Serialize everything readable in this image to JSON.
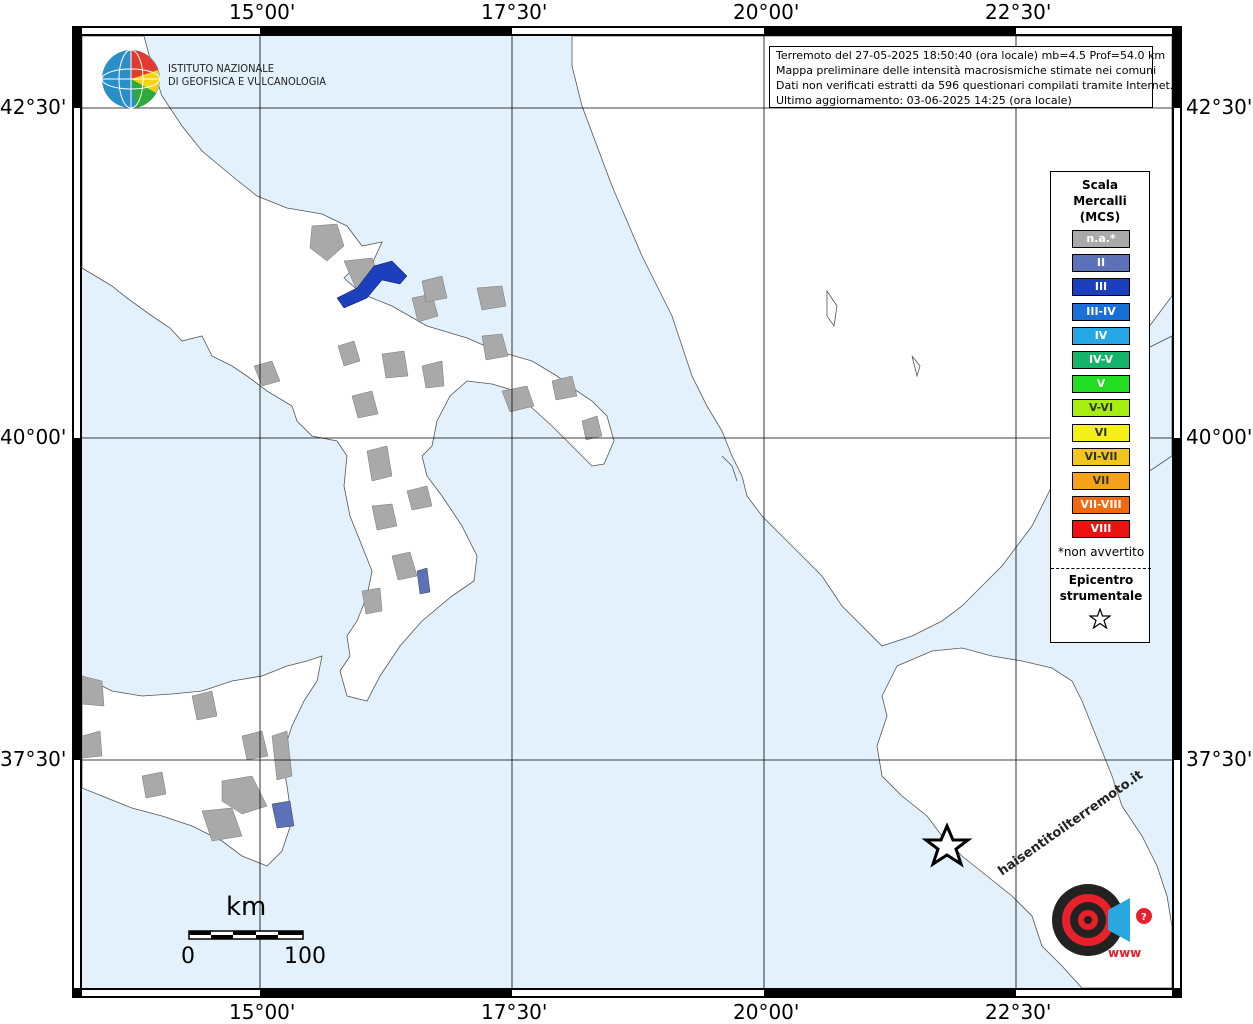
{
  "map": {
    "lon_labels_top": [
      "15°00'",
      "17°30'",
      "20°00'",
      "22°30'"
    ],
    "lon_labels_bottom": [
      "15°00'",
      "17°30'",
      "20°00'",
      "22°30'"
    ],
    "lat_labels_left": [
      "42°30'",
      "40°00'",
      "37°30'"
    ],
    "lat_labels_right": [
      "42°30'",
      "40°00'",
      "37°30'"
    ]
  },
  "institute": {
    "line1": "ISTITUTO NAZIONALE",
    "line2": "DI GEOFISICA E VULCANOLOGIA"
  },
  "info": {
    "line1": "Terremoto del 27-05-2025 18:50:40 (ora locale) mb=4.5 Prof=54.0 km",
    "line2": "Mappa preliminare delle intensità macrosismiche stimate nei comuni",
    "line3": "Dati non verificati estratti da 596 questionari compilati tramite Internet.",
    "line4": "Ultimo aggiornamento: 03-06-2025 14:25 (ora locale)"
  },
  "legend": {
    "title1": "Scala",
    "title2": "Mercalli",
    "title3": "(MCS)",
    "items": [
      {
        "label": "n.a.*",
        "color": "#aaaaaa"
      },
      {
        "label": "II",
        "color": "#5b72b8"
      },
      {
        "label": "III",
        "color": "#1c3fbd"
      },
      {
        "label": "III-IV",
        "color": "#1a6ed8"
      },
      {
        "label": "IV",
        "color": "#25a7e6"
      },
      {
        "label": "IV-V",
        "color": "#16b36b"
      },
      {
        "label": "V",
        "color": "#22dd22"
      },
      {
        "label": "V-VI",
        "color": "#a6ee10"
      },
      {
        "label": "VI",
        "color": "#f5f01a"
      },
      {
        "label": "VI-VII",
        "color": "#f2c61a"
      },
      {
        "label": "VII",
        "color": "#f5a218"
      },
      {
        "label": "VII-VIII",
        "color": "#f0690f"
      },
      {
        "label": "VIII",
        "color": "#ee1111"
      }
    ],
    "note": "*non avvertito",
    "epicenter1": "Epicentro",
    "epicenter2": "strumentale"
  },
  "scale": {
    "unit": "km",
    "start": "0",
    "end": "100"
  },
  "hsit": {
    "text": "haisentitoilterremoto.it",
    "url": "www"
  }
}
